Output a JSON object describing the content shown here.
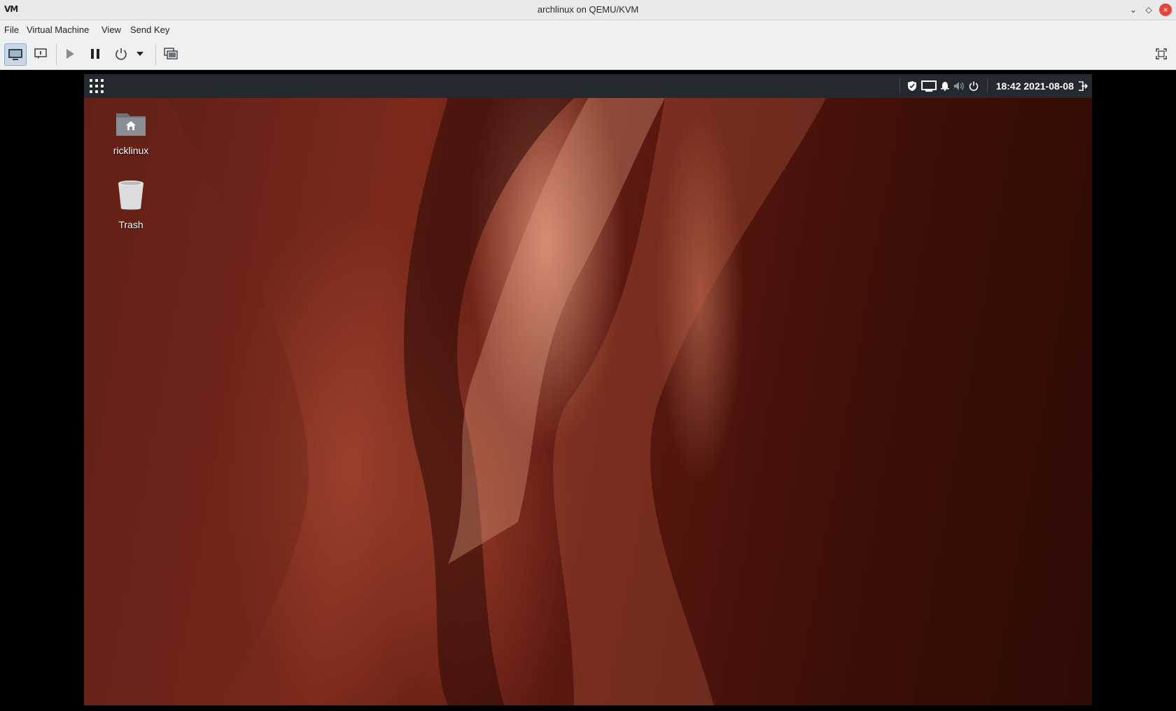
{
  "window": {
    "app_logo": "VM",
    "title": "archlinux on QEMU/KVM",
    "minimize_glyph": "⌄",
    "maximize_glyph": "◇",
    "close_glyph": "×"
  },
  "menubar": {
    "items": [
      "File",
      "Virtual Machine",
      "View",
      "Send Key"
    ]
  },
  "toolbar": {
    "buttons": [
      "console-view",
      "details-view",
      "run",
      "pause",
      "shutdown",
      "shutdown-menu",
      "snapshots",
      "fullscreen"
    ],
    "active": "console-view"
  },
  "guest": {
    "panel": {
      "clock": "18:42 2021-08-08",
      "tray_icons": [
        "shield-icon",
        "monitor-icon",
        "bell-icon",
        "volume-icon",
        "power-icon"
      ]
    },
    "desktop_icons": [
      {
        "label": "ricklinux",
        "icon": "home-folder-icon"
      },
      {
        "label": "Trash",
        "icon": "trash-icon"
      }
    ],
    "colors": {
      "panel_bg": "#242930",
      "wallpaper_dark": "#3e0f08",
      "wallpaper_light": "#e0a088"
    }
  }
}
